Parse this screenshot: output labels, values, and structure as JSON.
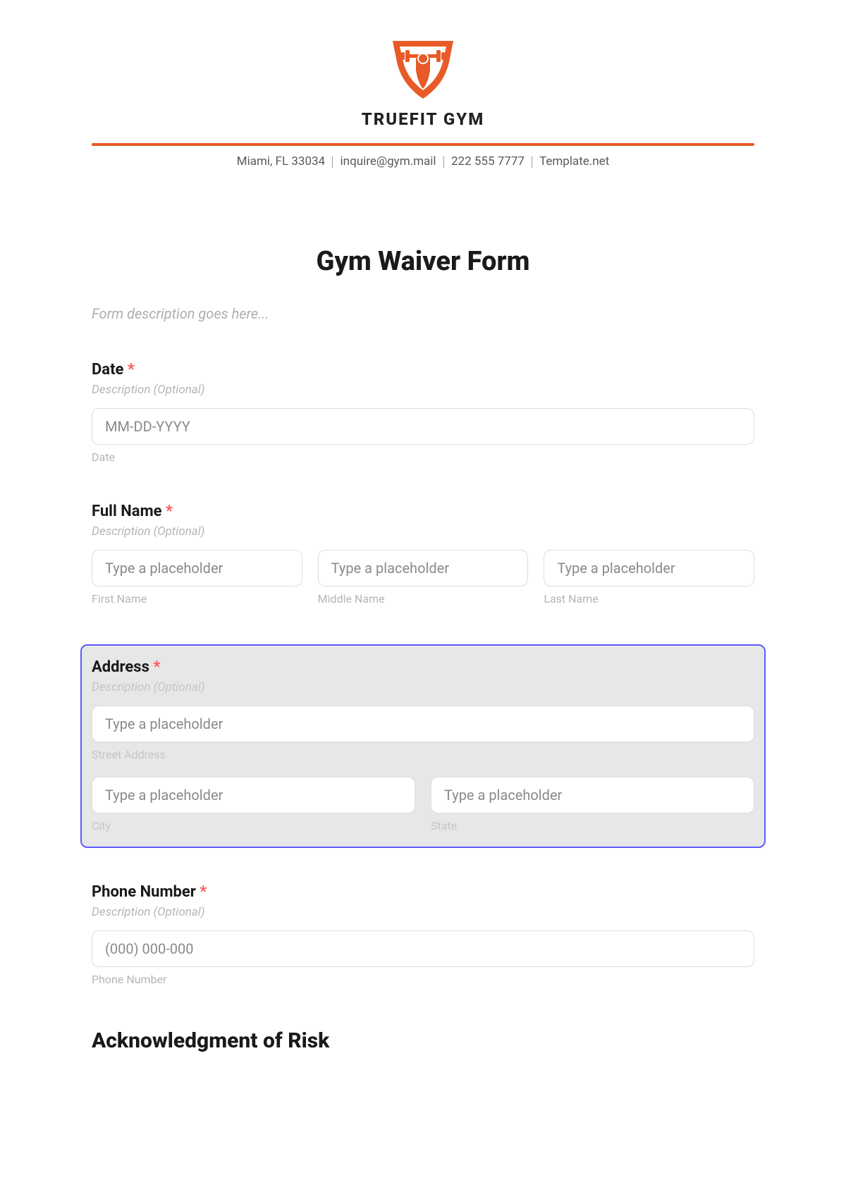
{
  "brand": {
    "name": "TRUEFIT GYM"
  },
  "contact": {
    "location": "Miami, FL 33034",
    "email": "inquire@gym.mail",
    "phone": "222 555 7777",
    "site": "Template.net"
  },
  "form": {
    "title": "Gym Waiver Form",
    "description_placeholder": "Form description goes here..."
  },
  "fields": {
    "date": {
      "label": "Date",
      "desc": "Description (Optional)",
      "placeholder": "MM-DD-YYYY",
      "sublabel": "Date"
    },
    "fullname": {
      "label": "Full Name",
      "desc": "Description (Optional)",
      "first": {
        "placeholder": "Type a placeholder",
        "sublabel": "First Name"
      },
      "middle": {
        "placeholder": "Type a placeholder",
        "sublabel": "Middle Name"
      },
      "last": {
        "placeholder": "Type a placeholder",
        "sublabel": "Last Name"
      }
    },
    "address": {
      "label": "Address",
      "desc": "Description (Optional)",
      "street": {
        "placeholder": "Type a placeholder",
        "sublabel": "Street Address"
      },
      "city": {
        "placeholder": "Type a placeholder",
        "sublabel": "City"
      },
      "state": {
        "placeholder": "Type a placeholder",
        "sublabel": "State"
      }
    },
    "phone": {
      "label": "Phone Number",
      "desc": "Description (Optional)",
      "placeholder": "(000) 000-000",
      "sublabel": "Phone Number"
    }
  },
  "ack": {
    "title": "Acknowledgment of Risk"
  },
  "required_mark": "*"
}
